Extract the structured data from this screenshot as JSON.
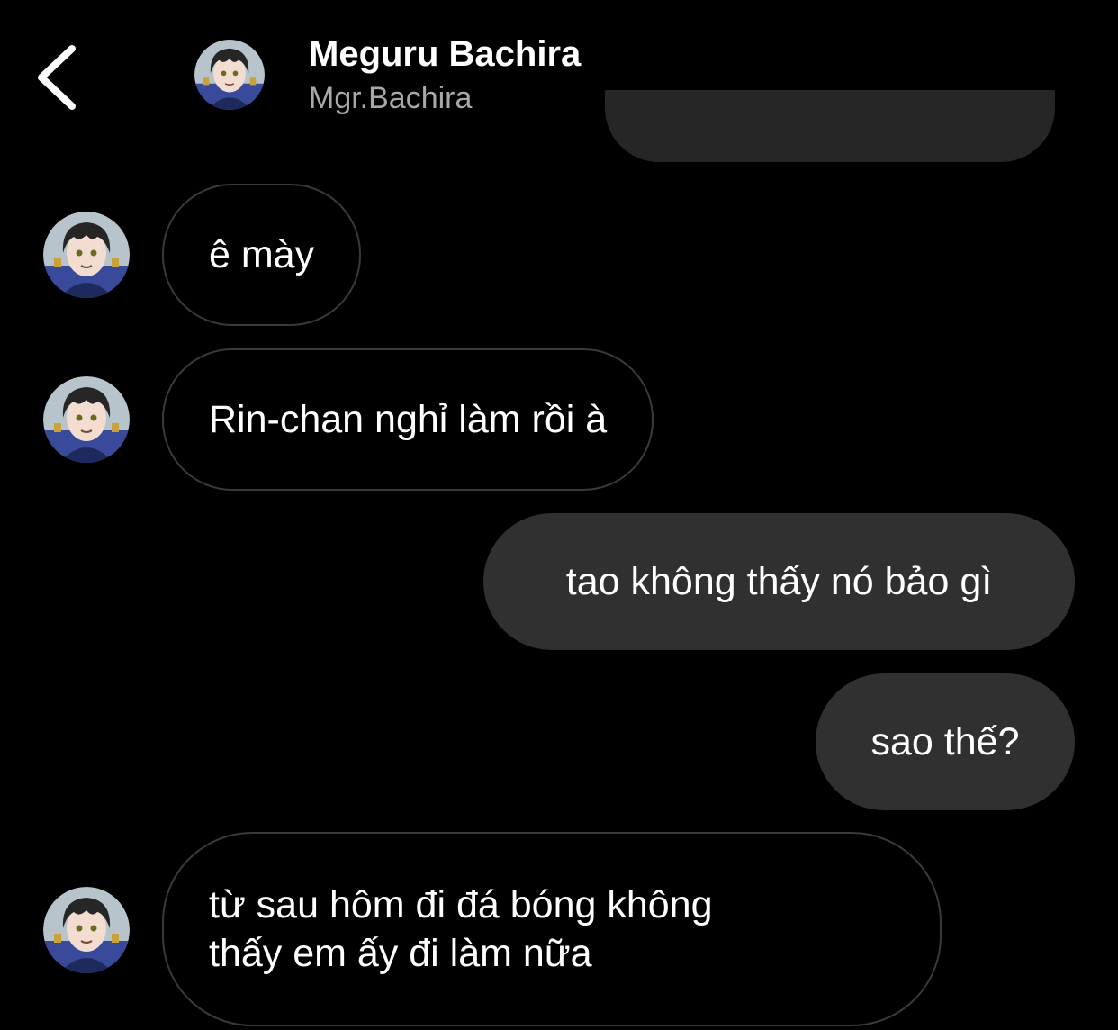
{
  "header": {
    "back_icon": "chevron-left-icon",
    "name": "Meguru Bachira",
    "handle": "Mgr.Bachira"
  },
  "colors": {
    "background": "#000000",
    "outgoing_bubble": "#303030",
    "incoming_border": "#3a3a3a",
    "secondary_text": "#a8a8a8"
  },
  "messages": [
    {
      "direction": "incoming",
      "text": "ê mày"
    },
    {
      "direction": "incoming",
      "text": "Rin-chan nghỉ làm rồi à"
    },
    {
      "direction": "outgoing",
      "text": "tao không thấy nó bảo gì"
    },
    {
      "direction": "outgoing",
      "text": "sao thế?"
    },
    {
      "direction": "incoming",
      "lines": [
        "từ sau hôm đi đá bóng không",
        "thấy em ấy đi làm nữa"
      ]
    }
  ]
}
